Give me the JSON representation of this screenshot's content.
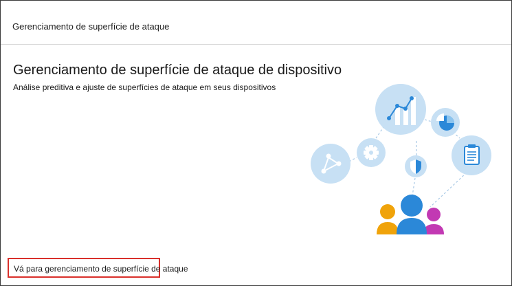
{
  "header": {
    "title": "Gerenciamento de superfície de ataque"
  },
  "main": {
    "title": "Gerenciamento de superfície de ataque de dispositivo",
    "subtitle": "Análise preditiva e ajuste de superfícies de ataque em seus dispositivos"
  },
  "illustration": {
    "icons": [
      "network-icon",
      "gear-icon",
      "chart-icon",
      "pie-chart-icon",
      "clipboard-icon",
      "shield-icon",
      "people-icon"
    ],
    "colors": {
      "circle": "#c7e0f4",
      "blue": "#2b88d8",
      "yellow": "#f0a30a",
      "magenta": "#c239b3"
    }
  },
  "footer": {
    "link_label": "Vá para gerenciamento de superfície de ataque",
    "highlight_color": "#d9302b"
  }
}
